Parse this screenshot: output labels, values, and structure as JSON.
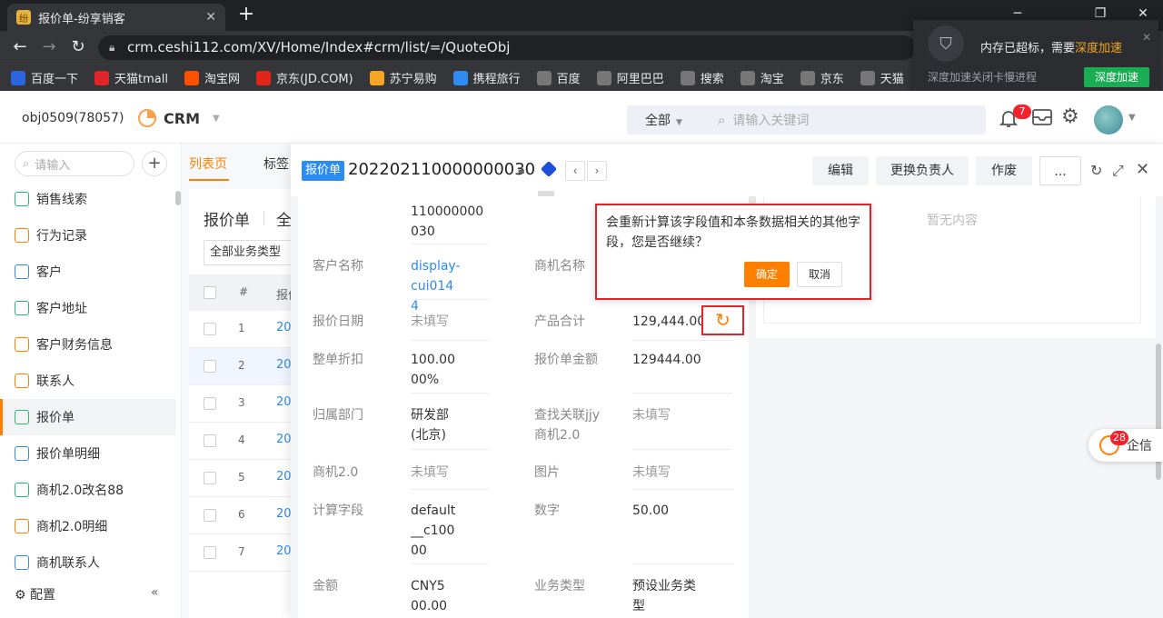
{
  "browser": {
    "tab_title": "报价单-纷享销客",
    "url": "crm.ceshi112.com/XV/Home/Index#crm/list/=/QuoteObj",
    "bookmarks": [
      {
        "label": "百度一下",
        "icon": "baidu-icon",
        "color": "#2d64e0"
      },
      {
        "label": "天猫tmall",
        "icon": "tmall-icon",
        "color": "#e0242a"
      },
      {
        "label": "淘宝网",
        "icon": "taobao-icon",
        "color": "#ff5000"
      },
      {
        "label": "京东(JD.COM)",
        "icon": "jd-icon",
        "color": "#e1251b"
      },
      {
        "label": "苏宁易购",
        "icon": "suning-icon",
        "color": "#f5a623"
      },
      {
        "label": "携程旅行",
        "icon": "ctrip-icon",
        "color": "#2d8cf0"
      },
      {
        "label": "百度",
        "icon": "globe-icon",
        "color": "#777"
      },
      {
        "label": "阿里巴巴",
        "icon": "globe-icon",
        "color": "#777"
      },
      {
        "label": "搜索",
        "icon": "globe-icon",
        "color": "#777"
      },
      {
        "label": "淘宝",
        "icon": "globe-icon",
        "color": "#777"
      },
      {
        "label": "京东",
        "icon": "globe-icon",
        "color": "#777"
      },
      {
        "label": "天猫",
        "icon": "globe-icon",
        "color": "#777"
      }
    ]
  },
  "notification": {
    "message": "内存已超标，需要",
    "highlight": "深度加速",
    "sub": "深度加速关闭卡慢进程",
    "button": "深度加速"
  },
  "header": {
    "account": "obj0509(78057)",
    "app": "CRM",
    "search_scope": "全部",
    "search_placeholder": "请输入关键词",
    "notification_count": "7"
  },
  "sidebar": {
    "search_placeholder": "请输入",
    "items": [
      {
        "label": "销售线索",
        "icon": "g"
      },
      {
        "label": "行为记录",
        "icon": "o"
      },
      {
        "label": "客户",
        "icon": "b"
      },
      {
        "label": "客户地址",
        "icon": "g"
      },
      {
        "label": "客户财务信息",
        "icon": "o"
      },
      {
        "label": "联系人",
        "icon": "o"
      },
      {
        "label": "报价单",
        "icon": "g"
      },
      {
        "label": "报价单明细",
        "icon": "b"
      },
      {
        "label": "商机2.0改名88",
        "icon": "g"
      },
      {
        "label": "商机2.0明细",
        "icon": "o"
      },
      {
        "label": "商机联系人",
        "icon": "b"
      }
    ],
    "config": "配置"
  },
  "list": {
    "tab_list": "列表页",
    "tab_label": "标签",
    "title": "报价单",
    "scope": "全",
    "type_select": "全部业务类型",
    "col_num": "#",
    "col_name": "报价",
    "rows": [
      {
        "n": "1",
        "v": "20"
      },
      {
        "n": "2",
        "v": "20"
      },
      {
        "n": "3",
        "v": "20"
      },
      {
        "n": "4",
        "v": "20"
      },
      {
        "n": "5",
        "v": "20"
      },
      {
        "n": "6",
        "v": "20"
      },
      {
        "n": "7",
        "v": "20"
      }
    ]
  },
  "detail": {
    "tag": "报价单",
    "title": "202202110000000030",
    "buttons": {
      "edit": "编辑",
      "change_owner": "更换负责人",
      "void": "作废",
      "more": "..."
    },
    "no_content": "暂无内容",
    "fields": {
      "name_value": "110000000030",
      "customer_label": "客户名称",
      "customer_value": "display-cui0144",
      "opportunity_label": "商机名称",
      "quote_date_label": "报价日期",
      "quote_date_value": "未填写",
      "product_total_label": "产品合计",
      "product_total_value": "129,444.00",
      "discount_label": "整单折扣",
      "discount_value": "100.0000%",
      "amount_label": "报价单金额",
      "amount_value": "129444.00",
      "dept_label": "归属部门",
      "dept_value": "研发部(北京)",
      "lookup_label": "查找关联jjy商机2.0",
      "lookup_value": "未填写",
      "opp2_label": "商机2.0",
      "opp2_value": "未填写",
      "image_label": "图片",
      "image_value": "未填写",
      "calc_label": "计算字段",
      "calc_value": "default__c10000",
      "number_label": "数字",
      "number_value": "50.00",
      "money_label": "金额",
      "money_value": "CNY500.00",
      "biztype_label": "业务类型",
      "biztype_value": "预设业务类型"
    }
  },
  "recalc_popup": {
    "message": "会重新计算该字段值和本条数据相关的其他字段，您是否继续？",
    "confirm": "确定",
    "cancel": "取消"
  },
  "qixin": {
    "label": "企信",
    "badge": "28"
  }
}
